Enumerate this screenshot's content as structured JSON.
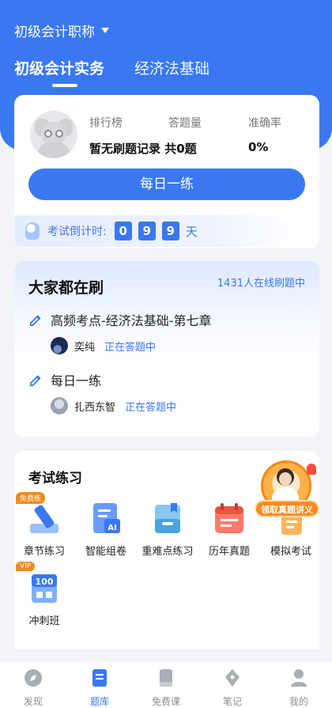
{
  "header": {
    "cert_label": "初级会计职称",
    "tabs": [
      {
        "label": "初级会计实务",
        "active": true
      },
      {
        "label": "经济法基础",
        "active": false
      }
    ]
  },
  "stats": {
    "ranking_label": "排行榜",
    "questions_label": "答题量",
    "accuracy_label": "准确率",
    "ranking_value": "暂无刷题记录",
    "questions_value": "共0题",
    "accuracy_value": "0%",
    "daily_button": "每日一练"
  },
  "countdown": {
    "label": "考试倒计时:",
    "digits": [
      "0",
      "9",
      "9"
    ],
    "unit": "天"
  },
  "everyone": {
    "title": "大家都在刷",
    "online": "1431人在线刷题中",
    "items": [
      {
        "title": "高频考点-经济法基础-第七章",
        "user": "奕纯",
        "status": "正在答题中"
      },
      {
        "title": "每日一练",
        "user": "扎西东智",
        "status": "正在答题中"
      }
    ]
  },
  "practice": {
    "title": "考试练习",
    "tools": [
      {
        "label": "章节练习",
        "icon": "pencil-ruler-icon",
        "tag": "免费练"
      },
      {
        "label": "智能组卷",
        "icon": "ai-document-icon"
      },
      {
        "label": "重难点练习",
        "icon": "inbox-tray-icon"
      },
      {
        "label": "历年真题",
        "icon": "calendar-icon"
      },
      {
        "label": "模拟考试",
        "icon": "exam-paper-icon"
      },
      {
        "label": "冲刺班",
        "icon": "score-100-icon",
        "tag": "VIP"
      }
    ],
    "promo_label": "领取真题讲义"
  },
  "nav": [
    {
      "label": "发现",
      "icon": "compass-icon",
      "active": false
    },
    {
      "label": "题库",
      "icon": "question-bank-icon",
      "active": true
    },
    {
      "label": "免费课",
      "icon": "book-icon",
      "active": false
    },
    {
      "label": "笔记",
      "icon": "pen-nib-icon",
      "active": false
    },
    {
      "label": "我的",
      "icon": "profile-icon",
      "active": false
    }
  ],
  "colors": {
    "primary": "#3a78f2",
    "accent_orange": "#f08a1c",
    "background": "#f2f4f8"
  }
}
